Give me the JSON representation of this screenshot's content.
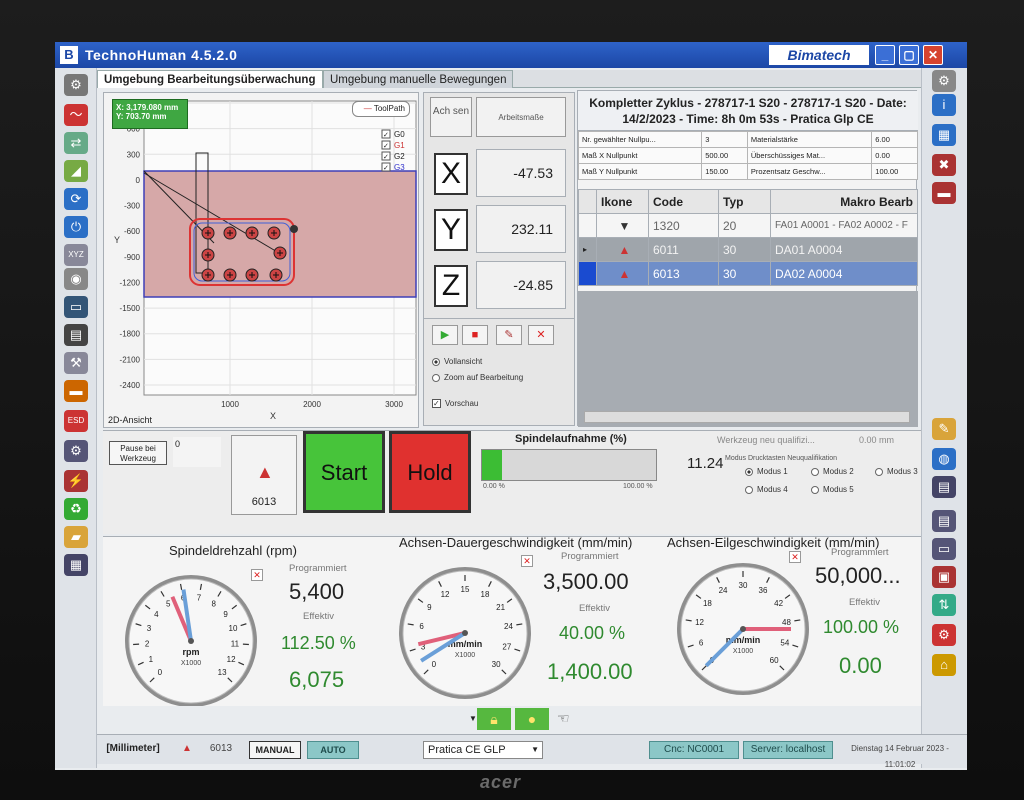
{
  "window": {
    "title": "TechnoHuman 4.5.2.0",
    "brand": "Bimatech",
    "app_icon": "B"
  },
  "monitor": {
    "brand": "acer"
  },
  "tabs": [
    {
      "label": "Umgebung Bearbeitungsüberwachung",
      "active": true
    },
    {
      "label": "Umgebung manuelle Bewegungen",
      "active": false
    }
  ],
  "plot": {
    "coord_x": "X: 3,179.080 mm",
    "coord_y": "Y: 703.70 mm",
    "toolpath_label": "ToolPath",
    "legend": [
      "G0",
      "G1",
      "G2",
      "G3"
    ],
    "yticks": [
      "900",
      "600",
      "300",
      "0",
      "-300",
      "-600",
      "-900",
      "-1200",
      "-1500",
      "-1800",
      "-2100",
      "-2400"
    ],
    "xticks": [
      "1000",
      "2000",
      "3000"
    ],
    "xlabel": "X",
    "ylabel": "Y",
    "tab_label": "2D-Ansicht"
  },
  "axes": {
    "header_left": "Ach sen",
    "header_right": "Arbeitsmaße",
    "rows": [
      {
        "axis": "X",
        "value": "-47.53"
      },
      {
        "axis": "Y",
        "value": "232.11"
      },
      {
        "axis": "Z",
        "value": "-24.85"
      }
    ]
  },
  "view_options": {
    "radio1": "Vollansicht",
    "radio2": "Zoom auf Bearbeitung",
    "checkbox": "Vorschau"
  },
  "cycle": {
    "title_line1": "Kompletter Zyklus - 278717-1 S20 - 278717-1 S20 - Date:",
    "title_line2": "14/2/2023 - Time: 8h 0m 53s - Pratica Glp CE",
    "params": [
      [
        "Nr. gewählter Nullpu...",
        "3",
        "Materialstärke",
        "6.00"
      ],
      [
        "Maß X Nullpunkt",
        "500.00",
        "Überschüssiges Mat...",
        "0.00"
      ],
      [
        "Maß Y Nullpunkt",
        "150.00",
        "Prozentsatz Geschw...",
        "100.00"
      ]
    ],
    "columns": [
      "Ikone",
      "Code",
      "Typ",
      "Makro Bearb"
    ],
    "rows": [
      {
        "code": "1320",
        "typ": "20",
        "macro": "FA01 A0001 - FA02 A0002 - F"
      },
      {
        "code": "6011",
        "typ": "30",
        "macro": "DA01 A0004"
      },
      {
        "code": "6013",
        "typ": "30",
        "macro": "DA02 A0004"
      }
    ]
  },
  "controls": {
    "pause_label": "Pause bei Werkzeug",
    "pause_value": "0",
    "tool_number": "6013",
    "start": "Start",
    "hold": "Hold",
    "spindle_title": "Spindelaufnahme (%)",
    "spindle_value": "11.24",
    "spindle_fraction": 0.1124,
    "prog_min": "0.00 %",
    "prog_max": "100.00 %",
    "tool_qualify": "Werkzeug neu qualifizi...",
    "tool_qualify_val": "0.00 mm",
    "modus_title": "Modus Drucktasten Neuqualifikation",
    "modus": [
      "Modus 1",
      "Modus 2",
      "Modus 3",
      "Modus 4",
      "Modus 5"
    ]
  },
  "gauges": [
    {
      "title": "Spindeldrehzahl (rpm)",
      "prog_label": "Programmiert",
      "prog": "5,400",
      "eff_label": "Effektiv",
      "pct": "112.50 %",
      "actual": "6,075",
      "unit": "rpm",
      "scale": "X1000",
      "ticks": [
        "0",
        "1",
        "2",
        "3",
        "4",
        "5",
        "6",
        "7",
        "8",
        "9",
        "10",
        "11",
        "12",
        "13"
      ],
      "max": 13,
      "needle": 6.1,
      "programmed_needle": 5.4
    },
    {
      "title": "Achsen-Dauergeschwindigkeit (mm/min)",
      "prog_label": "Programmiert",
      "prog": "3,500.00",
      "eff_label": "Effektiv",
      "pct": "40.00 %",
      "actual": "1,400.00",
      "unit": "mm/min",
      "scale": "X1000",
      "ticks": [
        "0",
        "3",
        "6",
        "9",
        "12",
        "15",
        "18",
        "21",
        "24",
        "27",
        "30"
      ],
      "max": 30,
      "needle": 1.4,
      "programmed_needle": 3.5
    },
    {
      "title": "Achsen-Eilgeschwindigkeit (mm/min)",
      "prog_label": "Programmiert",
      "prog": "50,000...",
      "eff_label": "Effektiv",
      "pct": "100.00 %",
      "actual": "0.00",
      "unit": "mm/min",
      "scale": "X1000",
      "ticks": [
        "0",
        "6",
        "12",
        "18",
        "24",
        "30",
        "36",
        "42",
        "48",
        "54",
        "60"
      ],
      "max": 60,
      "needle": 0,
      "programmed_needle": 50
    }
  ],
  "status": {
    "unit": "[Millimeter]",
    "tool": "6013",
    "manual": "MANUAL",
    "auto": "AUTO",
    "machine_select": "Pratica CE GLP",
    "cnc": "Cnc: NC0001",
    "server": "Server: localhost",
    "datetime": "Dienstag 14 Februar 2023 - 11:01:02"
  },
  "colors": {
    "title_blue": "#1c47a6",
    "start_green": "#47c43a",
    "hold_red": "#e0312f",
    "selection_blue": "#6f8ec9"
  }
}
